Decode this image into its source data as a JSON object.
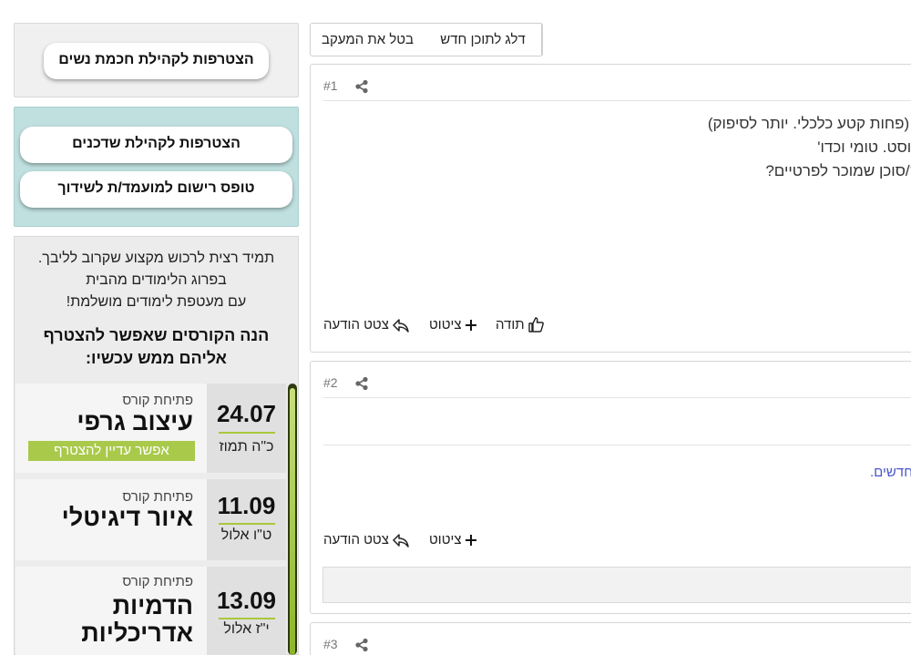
{
  "sidebar": {
    "join_women_button": "הצטרפות לקהילת חכמת נשים",
    "join_matchmakers_button": "הצטרפות לקהילת שדכנים",
    "candidate_form_button": "טופס רישום למועמד/ת לשידוך",
    "promo_lines": [
      "תמיד רצית לרכוש מקצוע שקרוב לליבך.",
      "בפרוג הלימודים מהבית",
      "עם מעטפת לימודים מושלמת!"
    ],
    "promo_heading_lines": [
      "הנה הקורסים שאפשר להצטרף",
      "אליהם ממש עכשיו:"
    ],
    "courses": [
      {
        "date": "24.07",
        "hebrew_date": "כ\"ה תמוז",
        "opening": "פתיחת קורס",
        "title": "עיצוב גרפי",
        "badge": "אפשר עדיין להצטרף"
      },
      {
        "date": "11.09",
        "hebrew_date": "ט\"ו אלול",
        "opening": "פתיחת קורס",
        "title": "איור דיגיטלי"
      },
      {
        "date": "13.09",
        "hebrew_date": "י\"ז אלול",
        "opening": "פתיחת קורס",
        "title_lines": [
          "הדמיות",
          "אדריכליות"
        ]
      }
    ]
  },
  "toolbar": {
    "skip_new_label": "דלג לתוכן חדש",
    "cancel_follow_label": "בטל את המעקב"
  },
  "posts": [
    {
      "number": "#1",
      "body_lines": [
        "תי (פחות קטע כלכלי. יותר לסיפוק)",
        "לקוסט. טומי וכדו'",
        "פק/סוכן שמוכר לפרטיים?"
      ],
      "thanks_label": "תודה",
      "quote_label": "ציטוט",
      "quote_post_label": "צטט הודעה"
    },
    {
      "number": "#2",
      "link_fragment": "חדשים.",
      "quote_label": "ציטוט",
      "quote_post_label": "צטט הודעה"
    },
    {
      "number": "#3"
    }
  ],
  "colors": {
    "teal_box": "#bfe0df",
    "green_accent": "#a9c94a",
    "link": "#4a55c8"
  }
}
